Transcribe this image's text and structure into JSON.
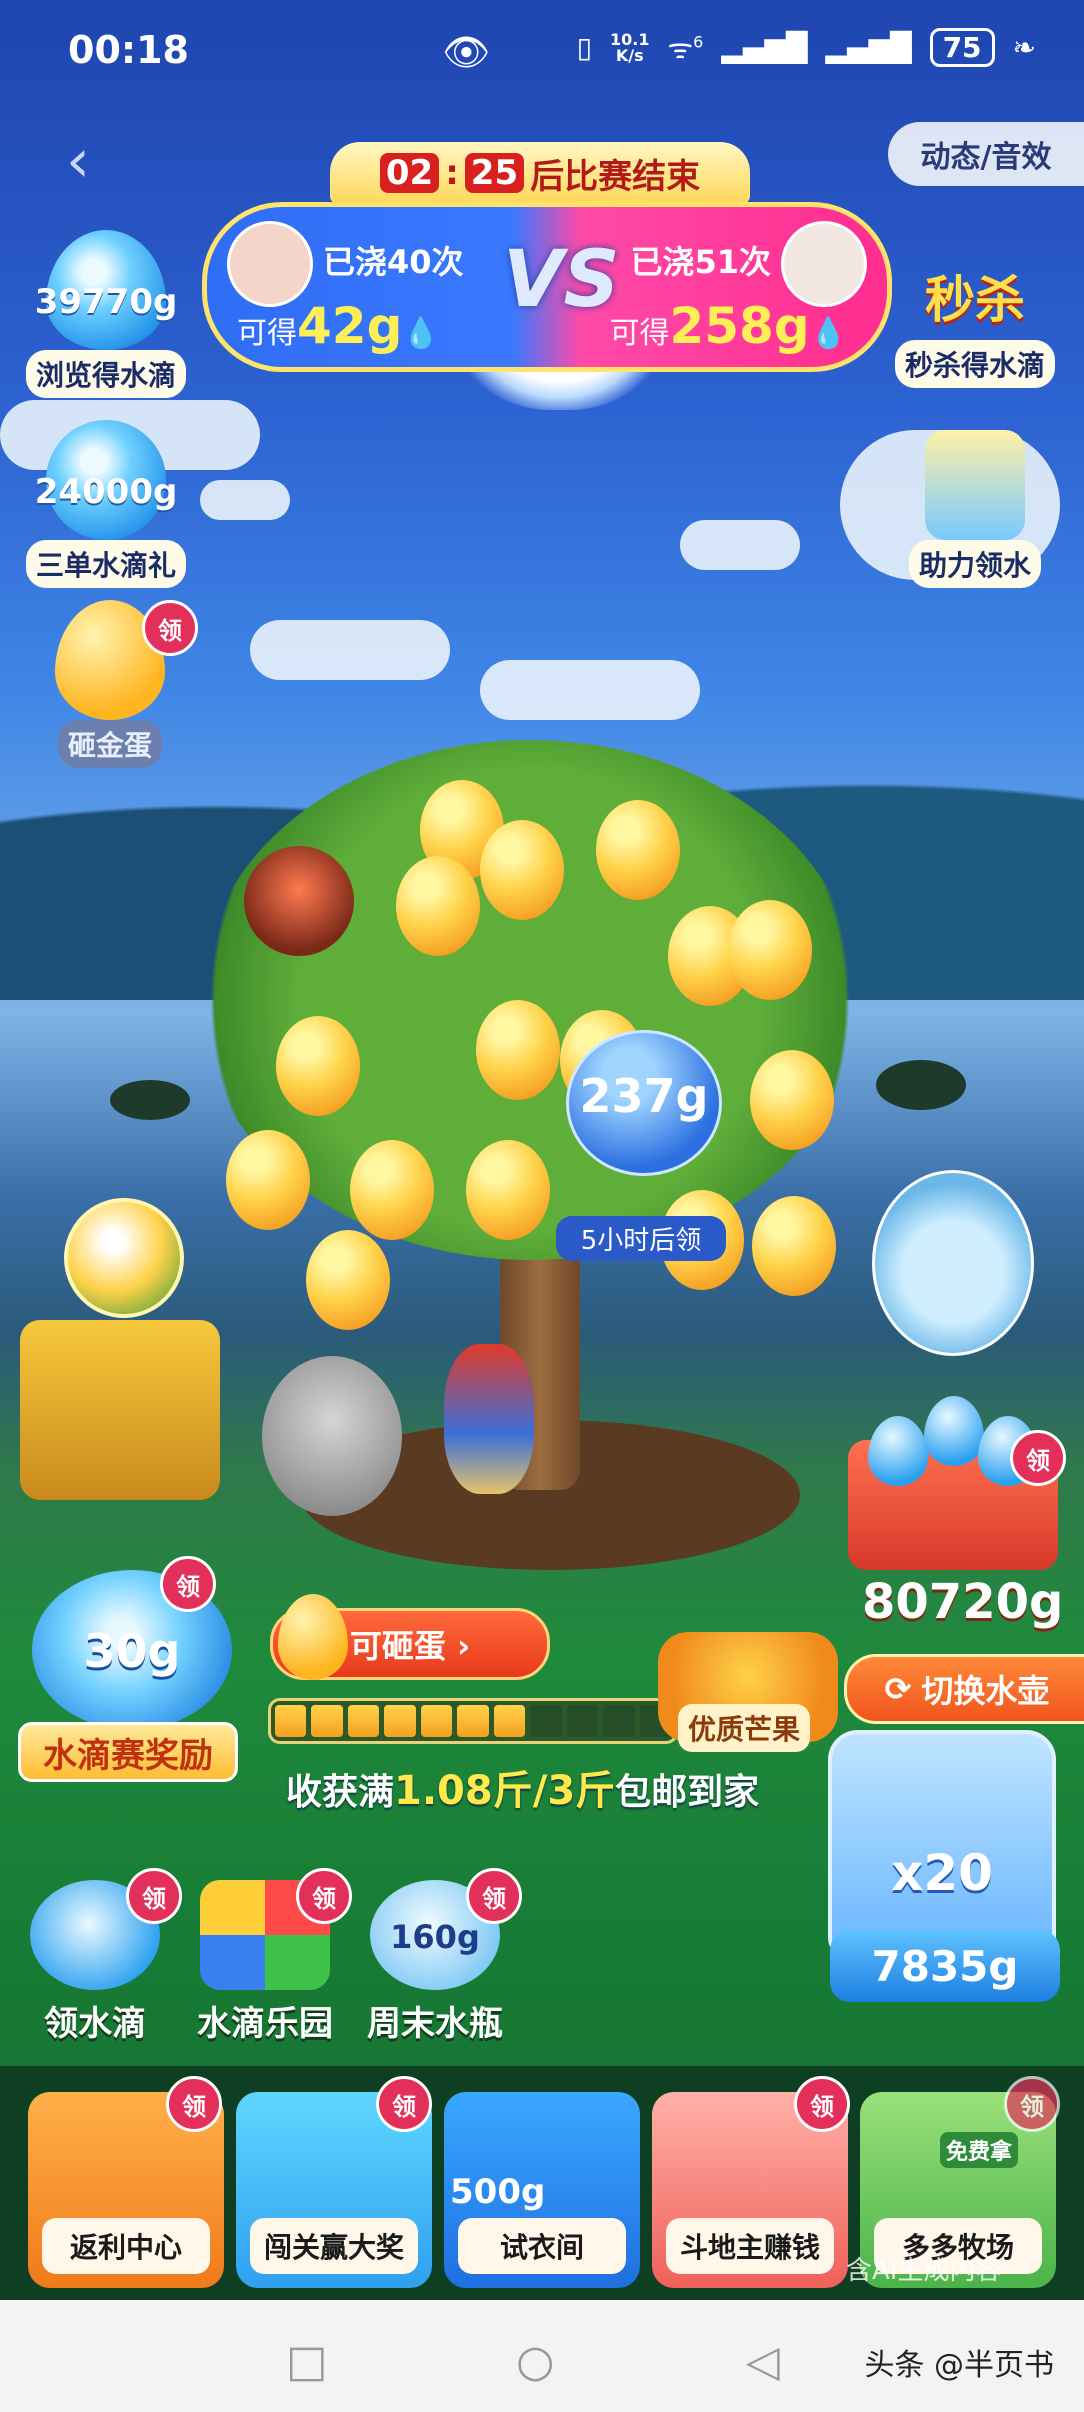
{
  "status_bar": {
    "time": "00:18",
    "net_speed_top": "10.1",
    "net_speed_unit": "K/s",
    "wifi_sup": "6",
    "battery": "75"
  },
  "header": {
    "effects_label": "动态/音效",
    "cd_minutes": "02",
    "cd_seconds": "25",
    "cd_suffix": "后比赛结束"
  },
  "vs": {
    "left": {
      "watered": "已浇40次",
      "gain_prefix": "可得",
      "gain_value": "42g"
    },
    "right": {
      "watered": "已浇51次",
      "gain_prefix": "可得",
      "gain_value": "258g"
    },
    "vs_text": "VS"
  },
  "left_badges": {
    "browse": {
      "grams": "39770g",
      "label": "浏览得水滴"
    },
    "three_orders": {
      "grams": "24000g",
      "label": "三单水滴礼"
    },
    "egg": {
      "label": "砸金蛋",
      "claim": "领"
    }
  },
  "right_badges": {
    "flash": {
      "art_text": "秒杀",
      "label": "秒杀得水滴"
    },
    "help": {
      "label": "助力领水"
    }
  },
  "tree": {
    "bottle_amount": "237g",
    "bottle_note": "5小时后领"
  },
  "cart": {
    "amount": "80720g",
    "claim": "领"
  },
  "reward": {
    "value": "30g",
    "label": "水滴赛奖励",
    "claim": "领"
  },
  "egg_button": {
    "label": "可砸蛋 ›"
  },
  "progress": {
    "filled_segments": 7,
    "total_segments": 11
  },
  "harvest": {
    "prefix": "收获满",
    "value": "1.08斤/3斤",
    "suffix": "包邮到家"
  },
  "basket": {
    "label": "优质芒果"
  },
  "switch_kettle": {
    "label": "切换水壶"
  },
  "kettle": {
    "multiplier": "x20",
    "amount": "7835g"
  },
  "icon_row": [
    {
      "label": "领水滴",
      "claim": "领"
    },
    {
      "label": "水滴乐园",
      "claim": "领"
    },
    {
      "label": "周末水瓶",
      "grams": "160g",
      "claim": "领"
    }
  ],
  "tray": [
    {
      "label": "返利中心",
      "claim": "领"
    },
    {
      "label": "闯关赢大奖",
      "claim": "领"
    },
    {
      "label": "试衣间",
      "amount": "500g"
    },
    {
      "label": "斗地主赚钱",
      "claim": "领"
    },
    {
      "label": "多多牧场",
      "claim": "领",
      "art_text": "免费拿"
    }
  ],
  "ai_note": "含AI生成内容",
  "navbar": {
    "watermark": "头条 @半页书"
  },
  "colors": {
    "accent_yellow": "#ffe94d",
    "claim_red": "#e3305a",
    "vs_blue": "#2f6ef4",
    "vs_pink": "#ff2d8f"
  }
}
